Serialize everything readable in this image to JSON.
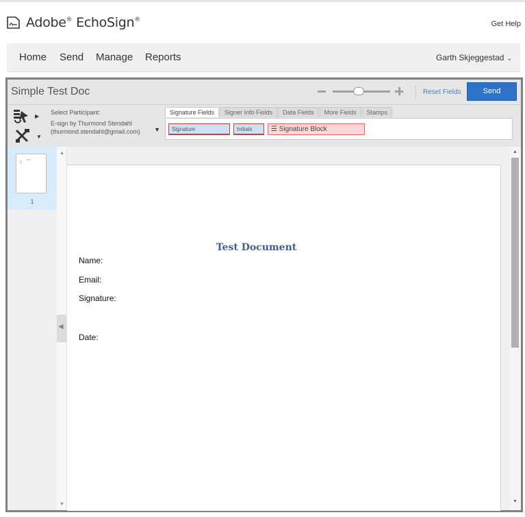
{
  "header": {
    "logo_text": "Adobe",
    "logo_text_2": "EchoSign",
    "get_help": "Get Help"
  },
  "nav": {
    "items": [
      "Home",
      "Send",
      "Manage",
      "Reports"
    ],
    "user": "Garth Skjeggestad"
  },
  "editor": {
    "title": "Simple Test Doc",
    "zoom_level": 0.45,
    "reset_fields": "Reset Fields",
    "send": "Send"
  },
  "toolbar": {
    "participant_label": "Select Participant:",
    "participant_line1": "E-sign by Thurmond Stendahl",
    "participant_line2": "(thurmond.stendahl@gmail.com)",
    "tabs": [
      "Signature Fields",
      "Signer Info Fields",
      "Data Fields",
      "More Fields",
      "Stamps"
    ],
    "fields": {
      "signature": "Signature",
      "initials": "Initials",
      "signature_block": "Signature Block"
    }
  },
  "thumbnails": {
    "page_number": "1"
  },
  "document": {
    "heading": "Test Document",
    "lines": [
      "Name:",
      "Email:",
      "Signature:",
      "Date:"
    ]
  },
  "colors": {
    "send_button": "#2d73c8",
    "reset_link": "#4a7dc4",
    "heading": "#3e5e8f",
    "thumb_selected": "#d8ebfb",
    "field_chip_blue": "#d0e0f0",
    "field_chip_red": "#fbd6d6"
  }
}
